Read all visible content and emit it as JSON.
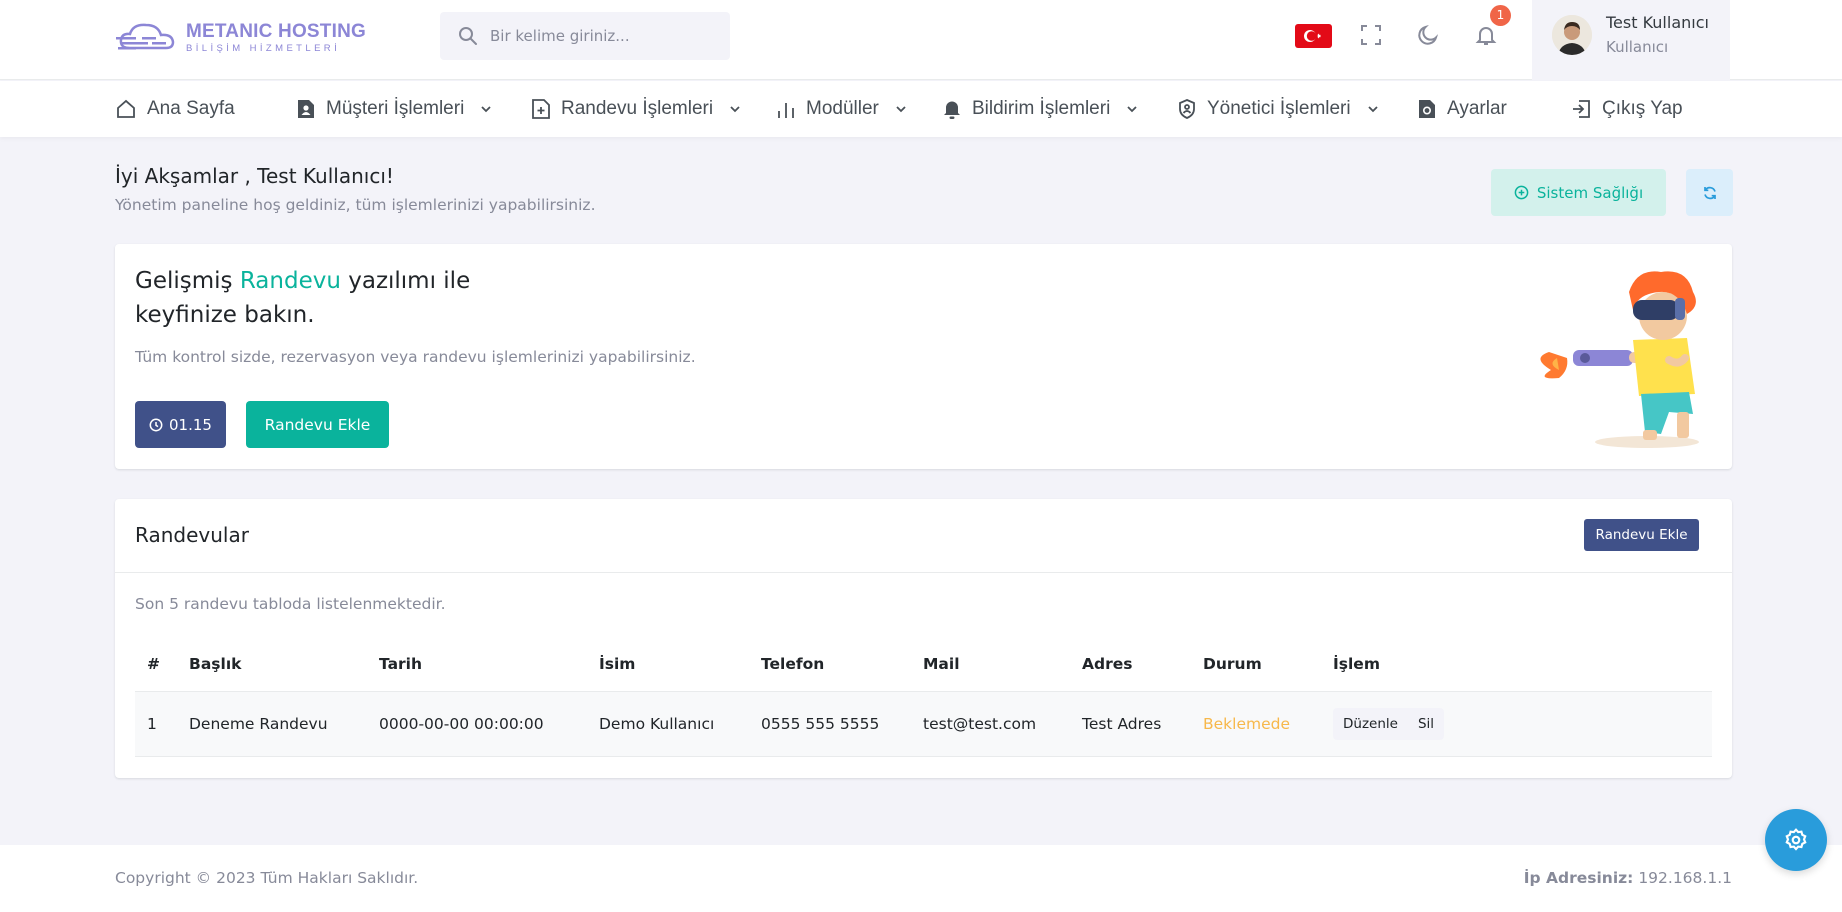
{
  "brand": {
    "name": "METANIC HOSTING",
    "tagline": "BİLİŞİM HİZMETLERİ",
    "color": "#8c86d6"
  },
  "search": {
    "placeholder": "Bir kelime giriniz..."
  },
  "header": {
    "icons": [
      "flag-tr-icon",
      "fullscreen-icon",
      "moon-icon",
      "bell-icon"
    ],
    "notification_count": "1",
    "user_name": "Test Kullanıcı",
    "user_role": "Kullanıcı"
  },
  "nav": {
    "items": [
      {
        "label": "Ana Sayfa",
        "icon": "home-icon",
        "dropdown": false
      },
      {
        "label": "Müşteri İşlemleri",
        "icon": "user-file-icon",
        "dropdown": true
      },
      {
        "label": "Randevu İşlemleri",
        "icon": "file-plus-icon",
        "dropdown": true
      },
      {
        "label": "Modüller",
        "icon": "bar-chart-icon",
        "dropdown": true
      },
      {
        "label": "Bildirim İşlemleri",
        "icon": "bell-icon",
        "dropdown": true
      },
      {
        "label": "Yönetici İşlemleri",
        "icon": "shield-user-icon",
        "dropdown": true
      },
      {
        "label": "Ayarlar",
        "icon": "settings-file-icon",
        "dropdown": false
      },
      {
        "label": "Çıkış Yap",
        "icon": "logout-icon",
        "dropdown": false
      }
    ]
  },
  "greeting": {
    "title": "İyi Akşamlar , Test Kullanıcı!",
    "subtitle": "Yönetim paneline hoş geldiniz, tüm işlemlerinizi yapabilirsiniz.",
    "health_button": "Sistem Sağlığı"
  },
  "hero": {
    "title_before": "Gelişmiş ",
    "title_accent": "Randevu",
    "title_after": " yazılımı ile keyfinize bakın.",
    "description": "Tüm kontrol sizde, rezervasyon veya randevu işlemlerinizi yapabilirsiniz.",
    "time_button": "01.15",
    "add_button": "Randevu Ekle"
  },
  "appointments": {
    "title": "Randevular",
    "add_button": "Randevu Ekle",
    "info": "Son 5 randevu tabloda listelenmektedir.",
    "columns": [
      "#",
      "Başlık",
      "Tarih",
      "İsim",
      "Telefon",
      "Mail",
      "Adres",
      "Durum",
      "İşlem"
    ],
    "rows": [
      {
        "no": "1",
        "title": "Deneme Randevu",
        "date": "0000-00-00 00:00:00",
        "name": "Demo Kullanıcı",
        "phone": "0555 555 5555",
        "mail": "test@test.com",
        "address": "Test Adres",
        "status": "Beklemede",
        "edit": "Düzenle",
        "delete": "Sil"
      }
    ]
  },
  "footer": {
    "copyright": "Copyright © 2023 Tüm Hakları Saklıdır.",
    "ip_label": "İp Adresiniz:",
    "ip_value": "192.168.1.1"
  },
  "colors": {
    "primary": "#405189",
    "success": "#0ab39c",
    "warning": "#f7b84b",
    "info": "#299cdb",
    "danger": "#f06548"
  }
}
